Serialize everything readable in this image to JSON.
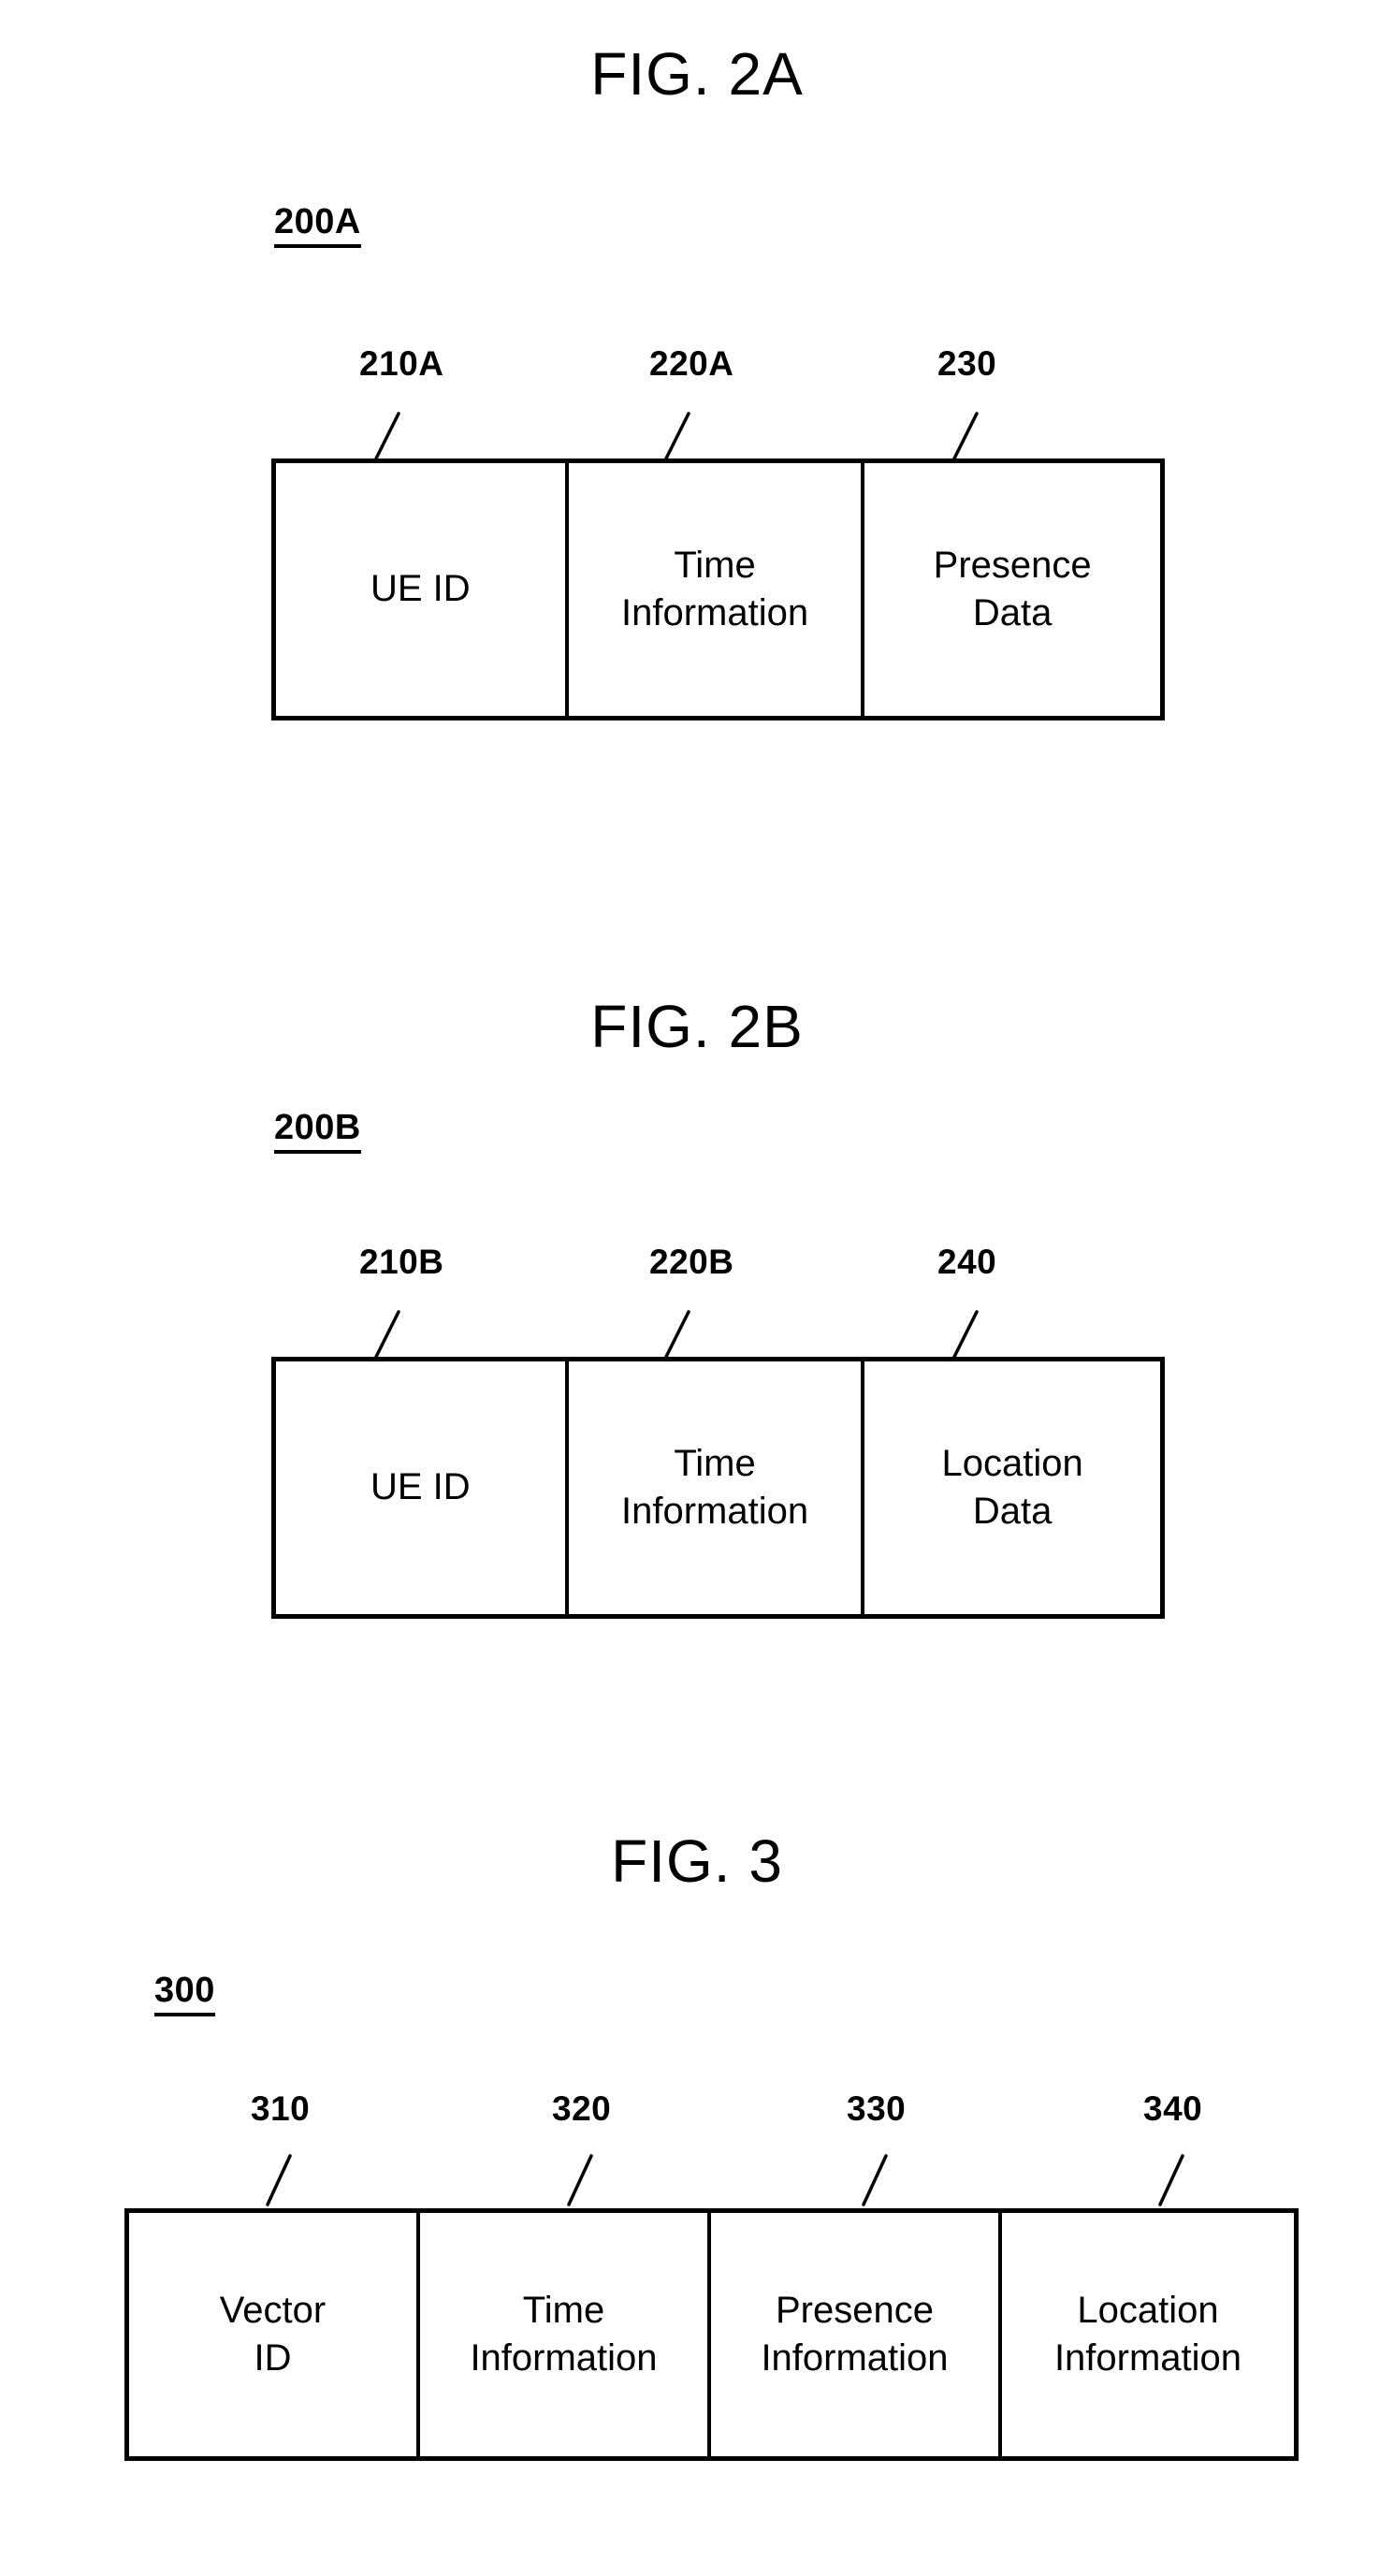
{
  "document": {
    "type": "patent-figure-sheet"
  },
  "figures": [
    {
      "title": "FIG. 2A",
      "ref_label": "200A",
      "callouts": [
        "210A",
        "220A",
        "230"
      ],
      "cells": [
        {
          "text": "UE ID"
        },
        {
          "text": "Time\nInformation"
        },
        {
          "text": "Presence\nData"
        }
      ]
    },
    {
      "title": "FIG. 2B",
      "ref_label": "200B",
      "callouts": [
        "210B",
        "220B",
        "240"
      ],
      "cells": [
        {
          "text": "UE ID"
        },
        {
          "text": "Time\nInformation"
        },
        {
          "text": "Location\nData"
        }
      ]
    },
    {
      "title": "FIG. 3",
      "ref_label": "300",
      "callouts": [
        "310",
        "320",
        "330",
        "340"
      ],
      "cells": [
        {
          "text": "Vector\nID"
        },
        {
          "text": "Time\nInformation"
        },
        {
          "text": "Presence\nInformation"
        },
        {
          "text": "Location\nInformation"
        }
      ]
    }
  ]
}
